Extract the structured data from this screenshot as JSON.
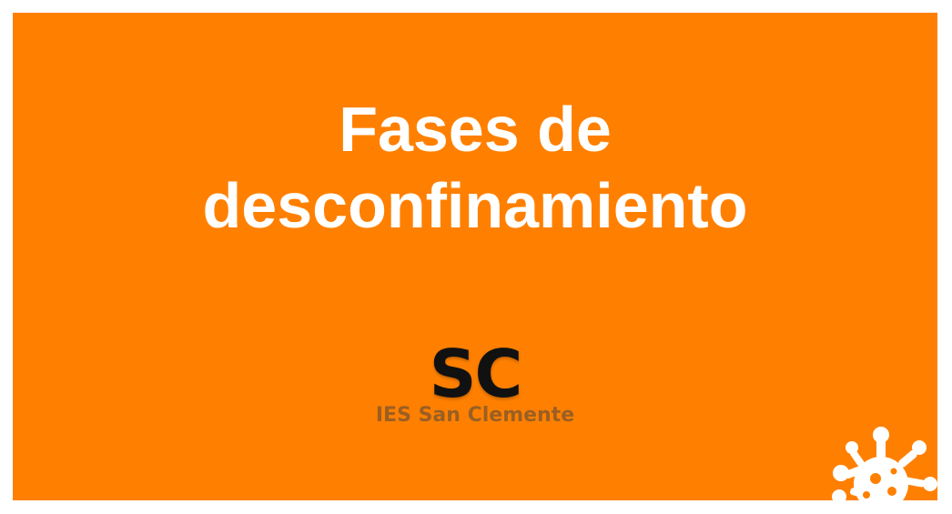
{
  "slide": {
    "background_color": "#ff8000",
    "title_lines": [
      "Fases de",
      "desconfinamiento"
    ],
    "logo": {
      "mark": "SC",
      "name": "IES San Clemente"
    },
    "decoration_icon": "virus-icon"
  }
}
